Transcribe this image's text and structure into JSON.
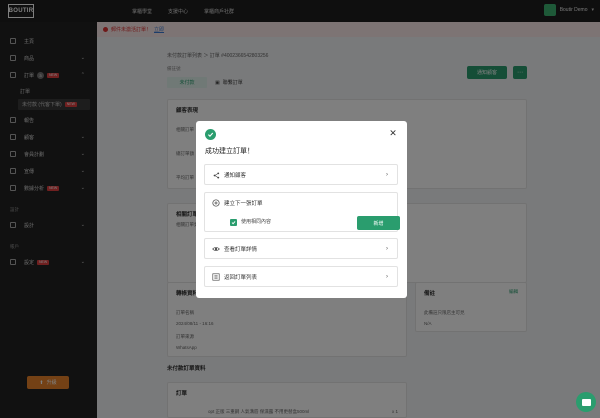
{
  "topbar": {
    "logo": "BOUTIR",
    "nav": [
      "掌櫃學堂",
      "支援中心",
      "掌櫃商戶社群"
    ],
    "store_name": "Boutir Demo"
  },
  "sidebar": {
    "items": [
      {
        "label": "主頁"
      },
      {
        "label": "商品"
      },
      {
        "label": "訂單",
        "count": "3",
        "badge": "NEW"
      },
      {
        "label": "報告"
      },
      {
        "label": "顧客"
      },
      {
        "label": "會員計劃"
      },
      {
        "label": "宣傳"
      },
      {
        "label": "數據分析",
        "badge": "NEW"
      },
      {
        "label": "設計"
      },
      {
        "label": "設定",
        "badge": "NEW"
      }
    ],
    "sub_items": [
      "訂單",
      "未付款 (代客下單)"
    ],
    "sub_badge": "NEW",
    "sections": [
      "設計",
      "帳戶"
    ],
    "upgrade_label": "升級"
  },
  "notice": {
    "text": "郵件未激活訂單！",
    "link": "立即"
  },
  "background": {
    "breadcrumb": "未付款訂單列表 ＞ 訂單 #4002366542803256",
    "sub_label": "備註號",
    "tab_active": "未付款",
    "tab_other": "聯繫訂單",
    "notify_button": "通知顧客",
    "card1_title": "顧客表現",
    "card1_rows": [
      "相關訂單",
      "總訂單額",
      "平均訂單"
    ],
    "card2_title": "相關訂單",
    "card2_text": "相關訂單資料",
    "info_title": "轉帳資料",
    "info_lines": [
      "訂單名稱",
      "2024/08/11 - 16:16",
      "訂單來源",
      "WhatsApp"
    ],
    "remark_title": "備註",
    "remark_edit": "編輯",
    "remark_text": "此備註只限店主可見",
    "remark_value": "N/A",
    "unpaid_section": "未付款訂單資料",
    "order_title": "訂單",
    "product_line": "opt 正版 三重鋼 人氣溝唇 保濕露 不用更替盒500ml",
    "product_qty": "x 1"
  },
  "modal": {
    "title": "成功建立訂單！",
    "option_notify": "通知顧客",
    "option_next": "建立下一張訂單",
    "checkbox_label": "使用相同內容",
    "new_button": "新增",
    "option_view": "查看訂單詳情",
    "option_back": "返回訂單列表"
  },
  "colors": {
    "accent": "#2a9d6e",
    "sidebar": "#222222",
    "upgrade": "#e8832a"
  }
}
